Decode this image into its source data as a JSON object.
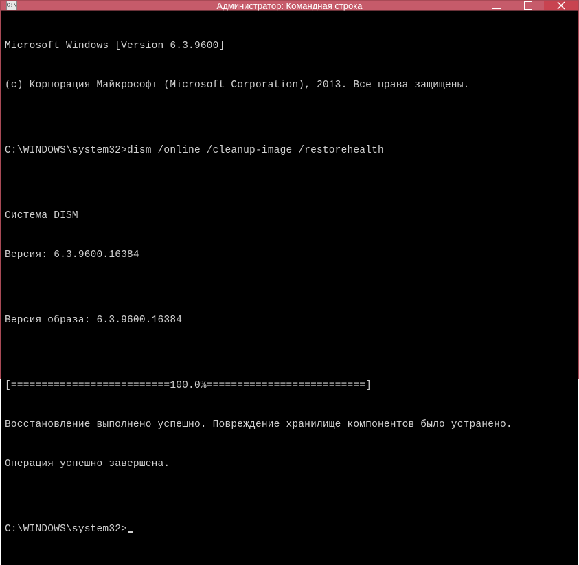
{
  "window": {
    "title": "Администратор: Командная строка",
    "icon_label": "CMD"
  },
  "terminal": {
    "lines": [
      "Microsoft Windows [Version 6.3.9600]",
      "(c) Корпорация Майкрософт (Microsoft Corporation), 2013. Все права защищены.",
      "",
      "C:\\WINDOWS\\system32>dism /online /cleanup-image /restorehealth",
      "",
      "Cистема DISM",
      "Версия: 6.3.9600.16384",
      "",
      "Версия образа: 6.3.9600.16384",
      "",
      "[==========================100.0%==========================]",
      "Восстановление выполнено успешно. Повреждение хранилище компонентов было устранено.",
      "Операция успешно завершена.",
      "",
      "C:\\WINDOWS\\system32>"
    ]
  }
}
